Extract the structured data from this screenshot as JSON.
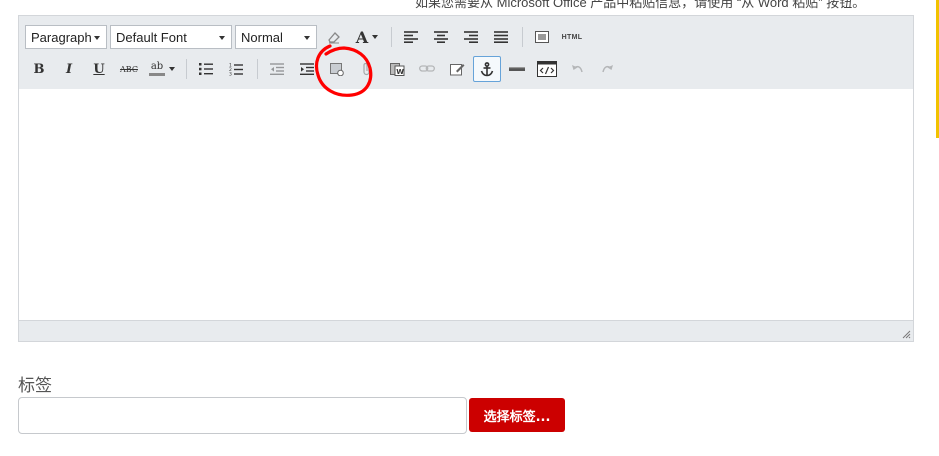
{
  "notice": {
    "text": "如果您需要从 Microsoft Office 产品中粘贴信息，请使用 “从 Word 粘贴” 按钮。"
  },
  "toolbar": {
    "block_format": "Paragraph",
    "font_family": "Default Font",
    "font_size": "Normal",
    "html_label": "HTML",
    "bold_label": "B",
    "italic_label": "I",
    "underline_label": "U",
    "strike_label": "ABC",
    "spell_label": "ab",
    "font_color_label": "A"
  },
  "tags": {
    "label": "标签",
    "input_value": "",
    "button_label": "选择标签..."
  },
  "colors": {
    "toolbar_bg": "#e8ebee",
    "accent_red": "#cc0000",
    "annotation_red": "#ff0000"
  }
}
